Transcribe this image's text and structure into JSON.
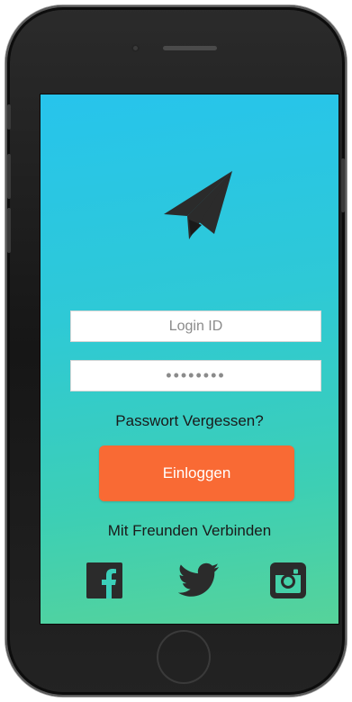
{
  "login": {
    "login_id_placeholder": "Login ID",
    "password_mask": "••••••••",
    "forgot_password": "Passwort Vergessen?",
    "login_button": "Einloggen",
    "connect_friends": "Mit Freunden Verbinden"
  },
  "icons": {
    "logo": "paper-plane-icon",
    "social": [
      "facebook-icon",
      "twitter-icon",
      "instagram-icon"
    ]
  },
  "colors": {
    "gradient_top": "#27c4ec",
    "gradient_bottom": "#56d39a",
    "button": "#f96a34",
    "icon": "#2b2b2b"
  }
}
